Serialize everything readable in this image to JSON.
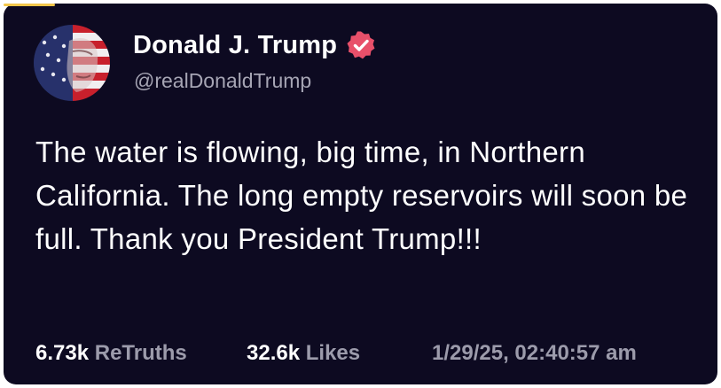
{
  "post": {
    "author_name": "Donald J. Trump",
    "handle": "@realDonaldTrump",
    "text": "The water is flowing, big time, in Northern California. The long empty reservoirs will soon be full. Thank you President Trump!!!",
    "retruths_count": "6.73k",
    "retruths_label": "ReTruths",
    "likes_count": "32.6k",
    "likes_label": "Likes",
    "timestamp": "1/29/25, 02:40:57 am"
  },
  "icons": {
    "avatar": "profile-avatar-flag",
    "verified": "verified-badge-icon"
  },
  "colors": {
    "background": "#0d0a21",
    "text": "#ffffff",
    "muted": "#9c9bab",
    "verified_badge": "#e8506a"
  }
}
